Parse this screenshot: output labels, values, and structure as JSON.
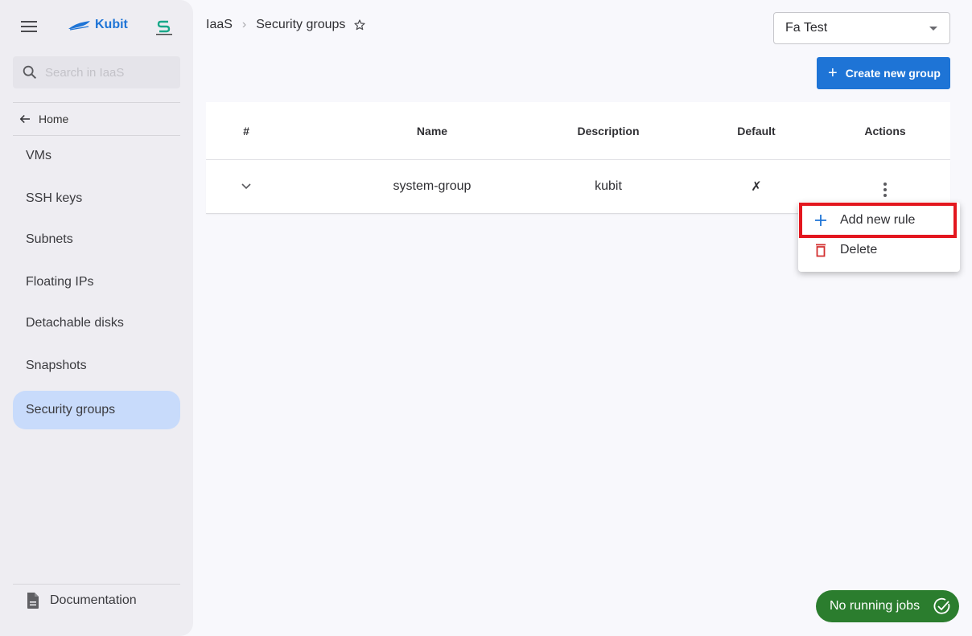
{
  "sidebar": {
    "brand": "Kubit",
    "search_placeholder": "Search in IaaS",
    "home_label": "Home",
    "items": [
      {
        "label": "VMs",
        "active": false
      },
      {
        "label": "SSH keys",
        "active": false
      },
      {
        "label": "Subnets",
        "active": false
      },
      {
        "label": "Floating IPs",
        "active": false
      },
      {
        "label": "Detachable disks",
        "active": false
      },
      {
        "label": "Snapshots",
        "active": false
      },
      {
        "label": "Security groups",
        "active": true
      }
    ],
    "documentation_label": "Documentation"
  },
  "header": {
    "breadcrumb": [
      "IaaS",
      "Security groups"
    ],
    "project_select": "Fa Test",
    "create_button": "Create new group"
  },
  "table": {
    "columns": [
      "#",
      "Name",
      "Description",
      "Default",
      "Actions"
    ],
    "rows": [
      {
        "name": "system-group",
        "description": "kubit",
        "default": "✗"
      }
    ]
  },
  "context_menu": {
    "items": [
      {
        "label": "Add new rule",
        "icon": "plus-icon",
        "highlighted": true
      },
      {
        "label": "Delete",
        "icon": "trash-icon",
        "highlighted": false
      }
    ]
  },
  "jobs_status": "No running jobs",
  "colors": {
    "primary": "#1e74d6",
    "active_nav": "#c8dbfb",
    "success": "#2b7d2e",
    "danger": "#d32f2f",
    "highlight": "#e3161e"
  }
}
